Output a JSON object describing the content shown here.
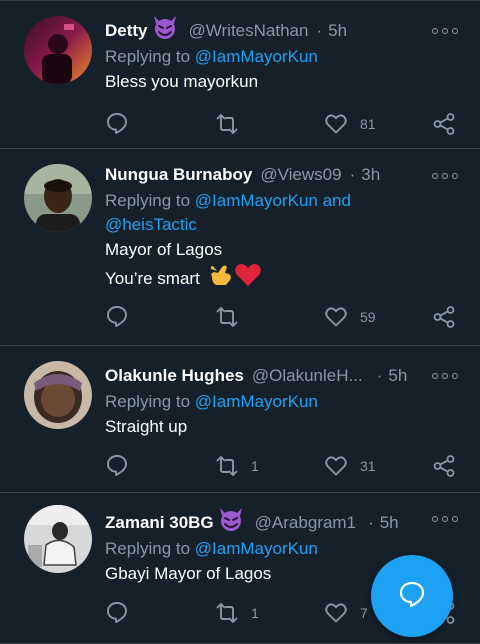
{
  "tweets": [
    {
      "name": "Detty",
      "name_emoji": "smiling-devil-icon",
      "handle": "@WritesNathan",
      "time": "5h",
      "reply_prefix": "Replying to ",
      "reply_to": "@IamMayorKun",
      "lines": [
        "Bless you mayorkun"
      ],
      "retweets": "",
      "likes": "81"
    },
    {
      "name": "Nungua Burnaboy",
      "handle": "@Views09",
      "time": "3h",
      "reply_prefix": "Replying to ",
      "reply_to": "@IamMayorKun and",
      "reply_to_2": "@heisTactic",
      "lines": [
        "Mayor of Lagos",
        "You’re smart"
      ],
      "line_emojis": [
        "call-me-hand-icon",
        "red-heart-icon"
      ],
      "retweets": "",
      "likes": "59"
    },
    {
      "name": "Olakunle Hughes",
      "handle": "@OlakunleH...",
      "time": "5h",
      "reply_prefix": "Replying to ",
      "reply_to": "@IamMayorKun",
      "lines": [
        "Straight up"
      ],
      "retweets": "1",
      "likes": "31"
    },
    {
      "name": "Zamani 30BG",
      "name_emoji": "smiling-devil-icon",
      "handle": "@Arabgram1",
      "time": "5h",
      "reply_prefix": "Replying to ",
      "reply_to": "@IamMayorKun",
      "lines": [
        "Gbayi Mayor of Lagos"
      ],
      "retweets": "1",
      "likes": "7"
    }
  ],
  "colors": {
    "background": "#15202b",
    "divider": "#38444d",
    "muted": "#8899a6",
    "link": "#1da1f2",
    "fab": "#1da1f2"
  },
  "fab_icon": "compose-reply-icon"
}
